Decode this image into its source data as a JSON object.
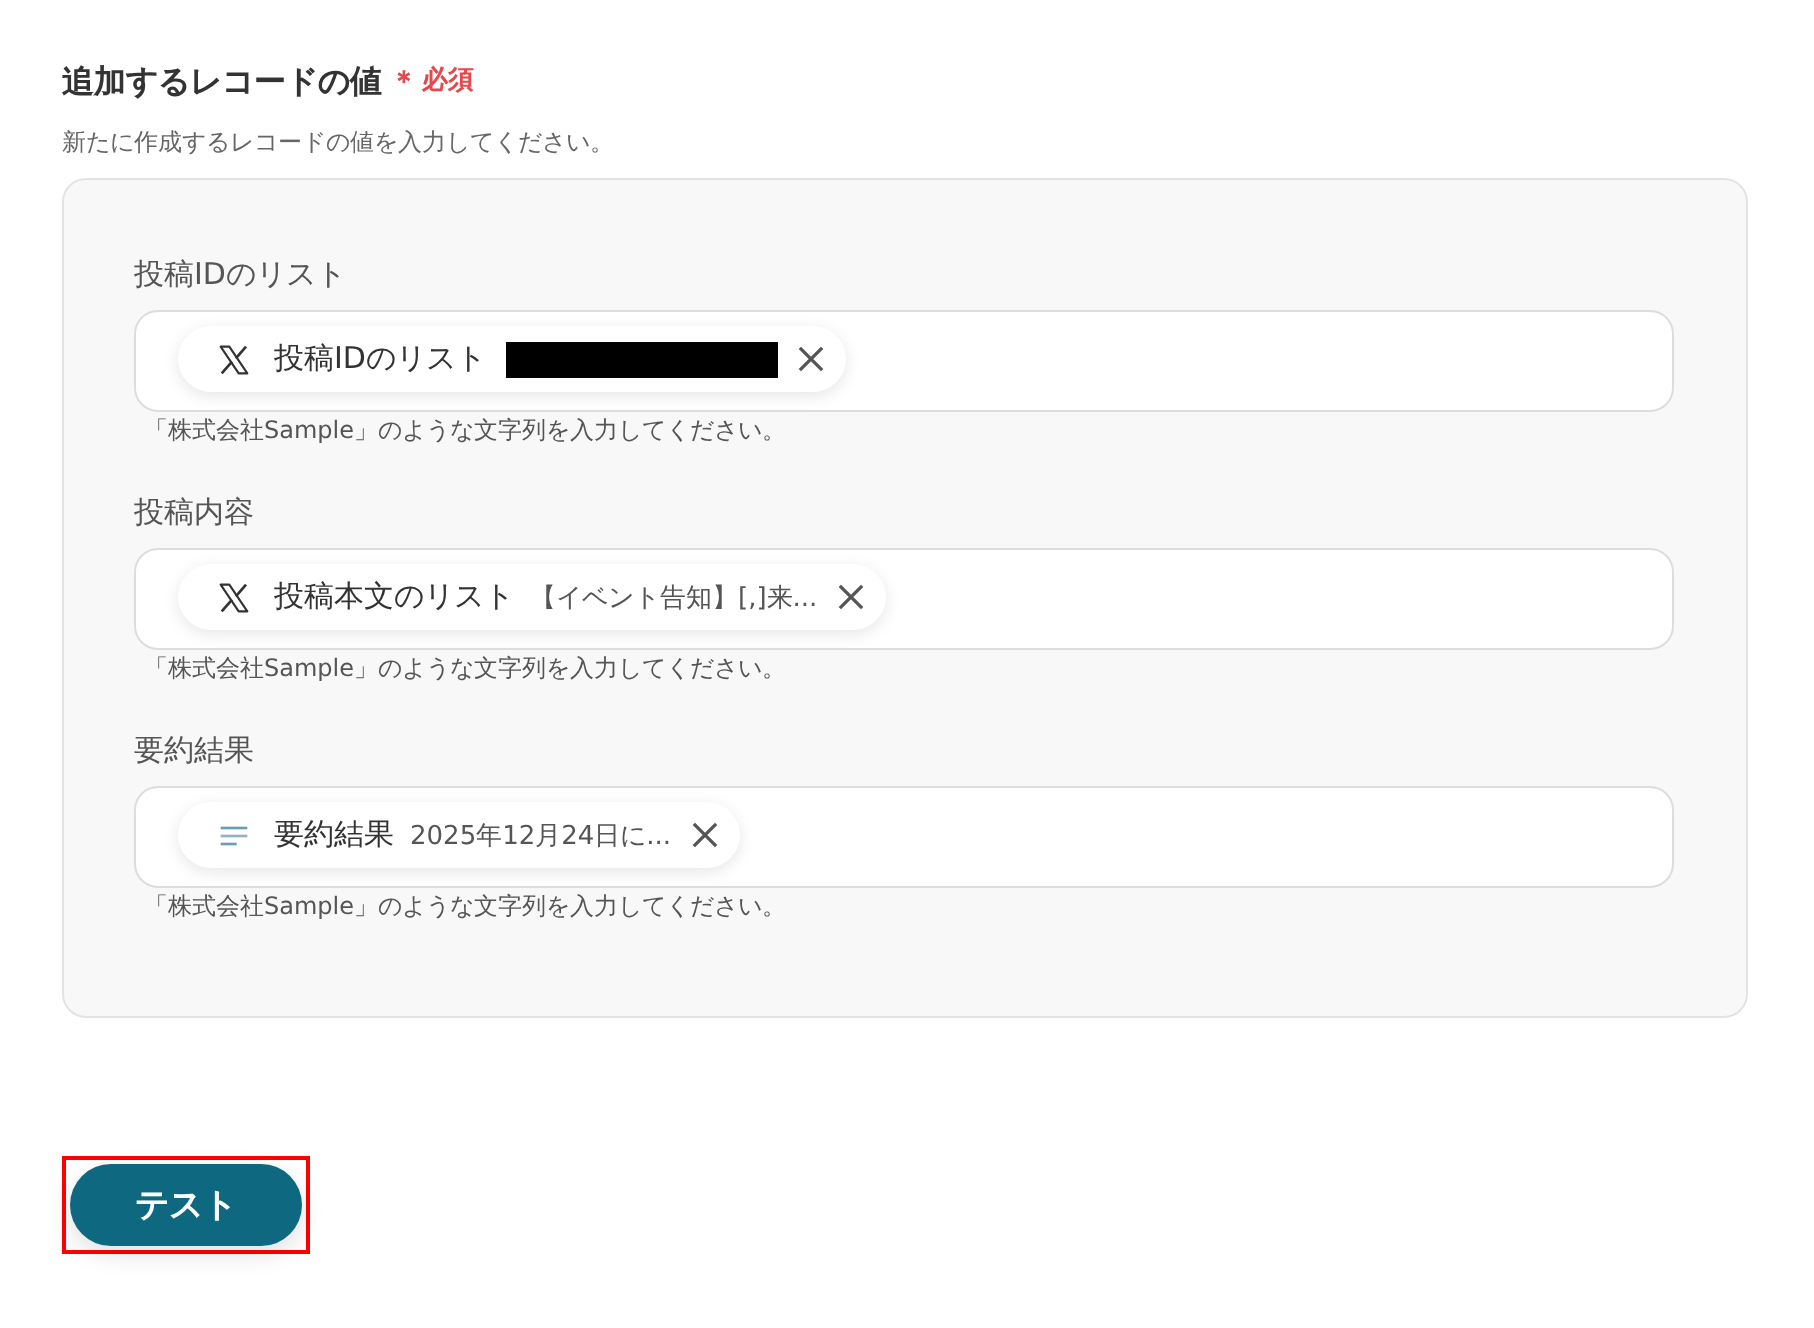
{
  "section": {
    "title": "追加するレコードの値",
    "required_mark": "＊",
    "required_label": "必須",
    "description": "新たに作成するレコードの値を入力してください。"
  },
  "fields": [
    {
      "label": "投稿IDのリスト",
      "chip": {
        "kind": "app",
        "name": "投稿IDのリスト",
        "redacted": true
      },
      "hint": "「株式会社Sample」のような文字列を入力してください。"
    },
    {
      "label": "投稿内容",
      "chip": {
        "kind": "app",
        "name": "投稿本文のリスト",
        "redacted": false,
        "value": "【イベント告知】[,]来..."
      },
      "hint": "「株式会社Sample」のような文字列を入力してください。"
    },
    {
      "label": "要約結果",
      "chip": {
        "kind": "step",
        "name": "要約結果",
        "redacted": false,
        "value": "2025年12月24日に..."
      },
      "hint": "「株式会社Sample」のような文字列を入力してください。"
    }
  ],
  "test_button": {
    "label": "テスト",
    "highlighted": true
  }
}
